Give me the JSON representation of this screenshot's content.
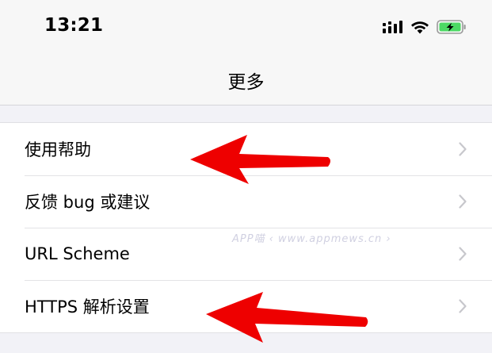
{
  "status_bar": {
    "time": "13:21",
    "icons": [
      "signal-icon",
      "wifi-icon",
      "battery-charging-icon"
    ]
  },
  "nav": {
    "title": "更多"
  },
  "rows": [
    {
      "label": "使用帮助"
    },
    {
      "label": "反馈 bug 或建议"
    },
    {
      "label": "URL Scheme"
    },
    {
      "label": "HTTPS 解析设置"
    }
  ],
  "watermark": {
    "text": "APP喵 ‹ www.appmews.cn ›"
  },
  "colors": {
    "annotation_arrow": "#ee0000",
    "battery_green": "#4cd964",
    "chevron": "#c7c7cc"
  }
}
